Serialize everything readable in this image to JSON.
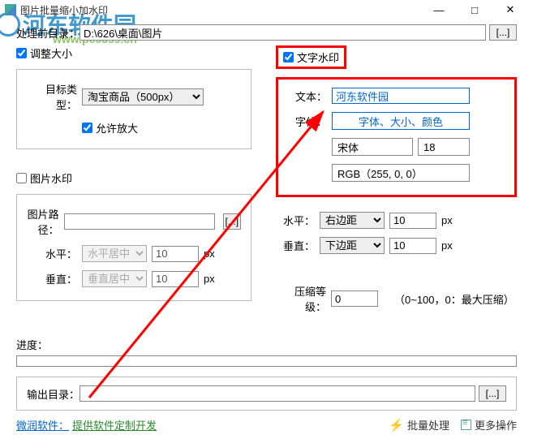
{
  "watermark_bg": {
    "text": "河东软件园",
    "sub": "www.pc0359.cn"
  },
  "titlebar": {
    "title": "图片批量缩小加水印"
  },
  "input_dir": {
    "label": "处理前目录：",
    "value": "D:\\626\\桌面\\图片",
    "browse": "[...]"
  },
  "resize": {
    "checkbox": "调整大小",
    "target_label": "目标类型：",
    "target_value": "淘宝商品（500px）",
    "allow_enlarge": "允许放大"
  },
  "image_wm": {
    "checkbox": "图片水印",
    "path_label": "图片路径：",
    "path_value": "",
    "browse": "[...]",
    "h_label": "水平：",
    "h_align": "水平居中",
    "h_offset": "10",
    "v_label": "垂直：",
    "v_align": "垂直居中",
    "v_offset": "10",
    "unit": "px"
  },
  "text_wm": {
    "checkbox": "文字水印",
    "text_label": "文本：",
    "text_value": "河东软件园",
    "font_label": "字体：",
    "font_btn": "字体、大小、颜色",
    "font_name": "宋体",
    "font_size": "18",
    "color": "RGB（255, 0, 0）",
    "h_label": "水平：",
    "h_align": "右边距",
    "h_offset": "10",
    "v_label": "垂直：",
    "v_align": "下边距",
    "v_offset": "10",
    "unit": "px"
  },
  "compress": {
    "label": "压缩等级：",
    "value": "0",
    "hint": "（0~100，0：最大压缩）"
  },
  "progress": {
    "label": "进度："
  },
  "output": {
    "label": "输出目录：",
    "value": "",
    "browse": "[...]"
  },
  "footer": {
    "vendor": "微润软件：",
    "service": "提供软件定制开发",
    "batch": "批量处理",
    "more": "更多操作"
  }
}
